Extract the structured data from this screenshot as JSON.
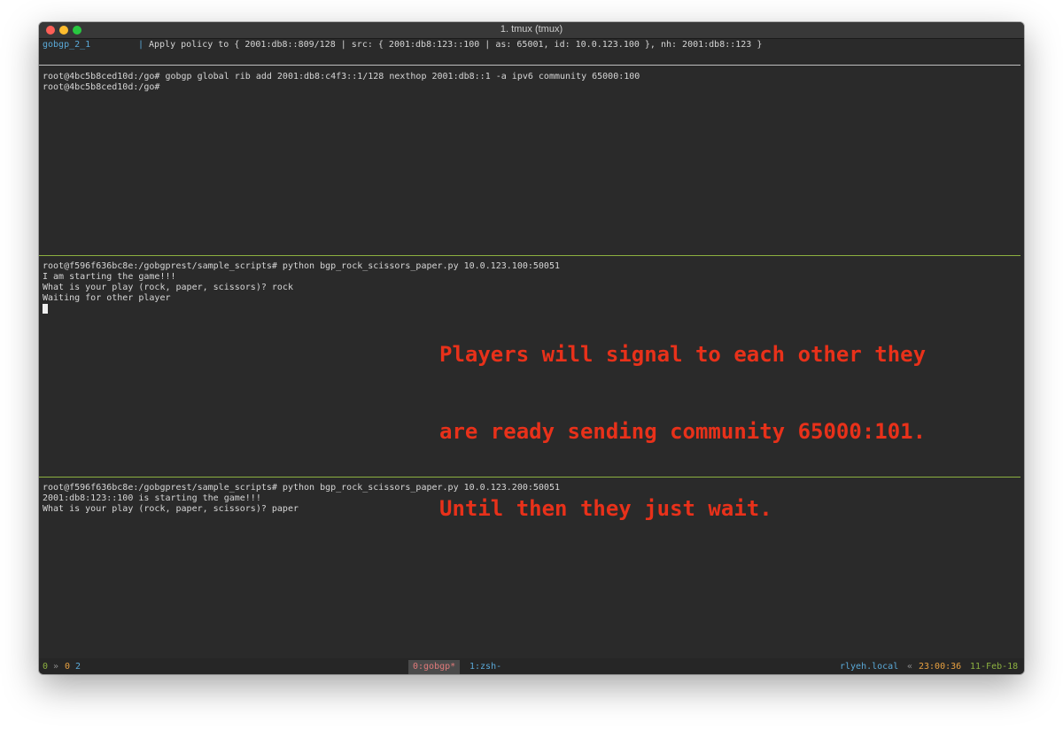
{
  "window": {
    "title": "1. tmux (tmux)"
  },
  "colors": {
    "close": "#fe5f57",
    "minimize": "#febc2e",
    "zoom": "#28c840",
    "annotation": "#e8311a",
    "pane_separator": "#8cb040"
  },
  "top_pane": {
    "name": "gobgp_2_1",
    "separator": "|",
    "message": "Apply policy to { 2001:db8::809/128 | src: { 2001:db8:123::100 | as: 65001, id: 10.0.123.100 }, nh: 2001:db8::123 }"
  },
  "pane1": {
    "lines": [
      "root@4bc5b8ced10d:/go# gobgp global rib add 2001:db8:c4f3::1/128 nexthop 2001:db8::1 -a ipv6 community 65000:100",
      "root@4bc5b8ced10d:/go#"
    ]
  },
  "pane2": {
    "lines": [
      "root@f596f636bc8e:/gobgprest/sample_scripts# python bgp_rock_scissors_paper.py 10.0.123.100:50051",
      "I am starting the game!!!",
      "What is your play (rock, paper, scissors)? rock",
      "Waiting for other player"
    ]
  },
  "annotation": {
    "lines": [
      "Players will signal to each other they",
      "are ready sending community 65000:101.",
      "Until then they just wait."
    ]
  },
  "pane3": {
    "lines": [
      "root@f596f636bc8e:/gobgprest/sample_scripts# python bgp_rock_scissors_paper.py 10.0.123.200:50051",
      "2001:db8:123::100 is starting the game!!!",
      "What is your play (rock, paper, scissors)? paper"
    ]
  },
  "status_bar": {
    "session": "0",
    "arrow": "»",
    "window_index": "0",
    "pane_index": "2",
    "active_window": "0:gobgp*",
    "other_window": "1:zsh-",
    "host": "rlyeh.local",
    "separator": "«",
    "time": "23:00:36",
    "date": "11-Feb-18"
  }
}
